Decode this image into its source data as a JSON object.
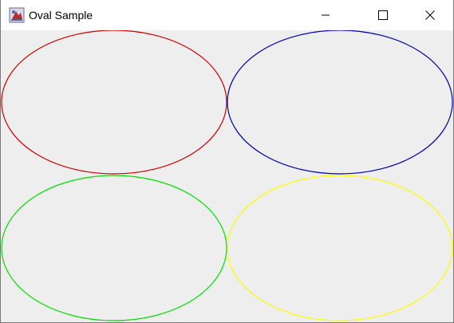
{
  "window": {
    "title": "Oval Sample",
    "icon": "java-app-icon"
  },
  "caption_buttons": {
    "minimize": "minimize-icon",
    "maximize": "maximize-icon",
    "close": "close-icon"
  },
  "canvas": {
    "background": "#eeeeee",
    "ovals": [
      {
        "name": "red-oval",
        "color": "#cc0000"
      },
      {
        "name": "blue-oval",
        "color": "#0000b0"
      },
      {
        "name": "green-oval",
        "color": "#00dd00"
      },
      {
        "name": "yellow-oval",
        "color": "#ffff00"
      }
    ]
  }
}
